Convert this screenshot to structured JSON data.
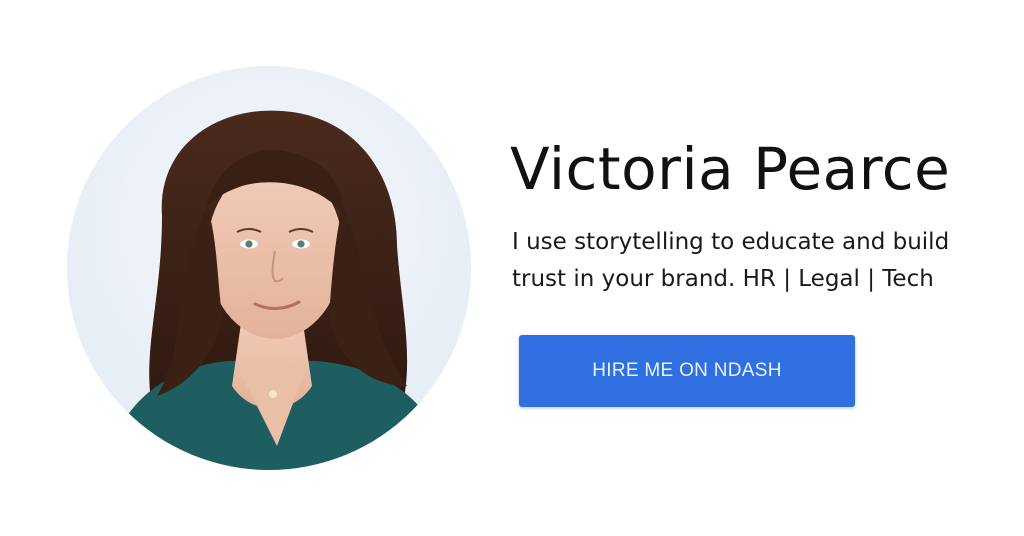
{
  "profile": {
    "name": "Victoria Pearce",
    "tagline_lines": [
      "I use storytelling to educate and build",
      "trust in your brand. HR | Legal | Tech"
    ],
    "photo_icon": "profile-photo"
  },
  "cta": {
    "label": "HIRE ME ON NDASH",
    "color": "#2f6fe0"
  }
}
